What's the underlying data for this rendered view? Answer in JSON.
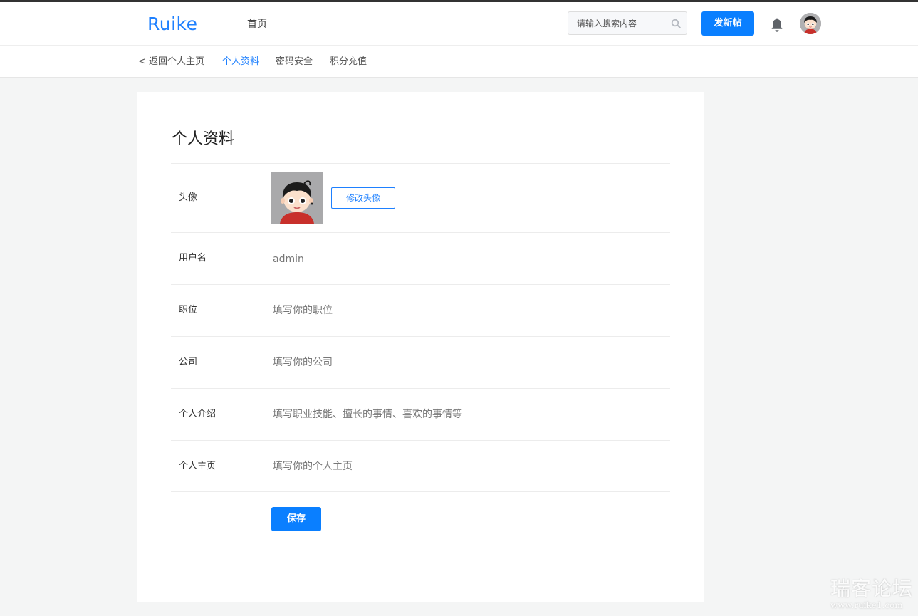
{
  "header": {
    "logo": "Ruike",
    "nav_home": "首页",
    "search_placeholder": "请输入搜索内容",
    "search_icon": "search-icon",
    "post_button": "发新帖",
    "bell_icon": "bell-icon",
    "avatar_icon": "user-avatar"
  },
  "subnav": {
    "back": "< 返回个人主页",
    "tabs": [
      "个人资料",
      "密码安全",
      "积分充值"
    ],
    "active_tab": "个人资料"
  },
  "profile": {
    "title": "个人资料",
    "avatar_label": "头像",
    "change_avatar": "修改头像",
    "username_label": "用户名",
    "username_value": "admin",
    "position_label": "职位",
    "position_placeholder": "填写你的职位",
    "company_label": "公司",
    "company_placeholder": "填写你的公司",
    "intro_label": "个人介绍",
    "intro_placeholder": "填写职业技能、擅长的事情、喜欢的事情等",
    "homepage_label": "个人主页",
    "homepage_placeholder": "填写你的个人主页",
    "save_button": "保存"
  },
  "watermark": {
    "name": "瑞客论坛",
    "url": "www.ruike1.com"
  },
  "colors": {
    "accent": "#0a7fff",
    "page_bg": "#f4f5f5"
  }
}
